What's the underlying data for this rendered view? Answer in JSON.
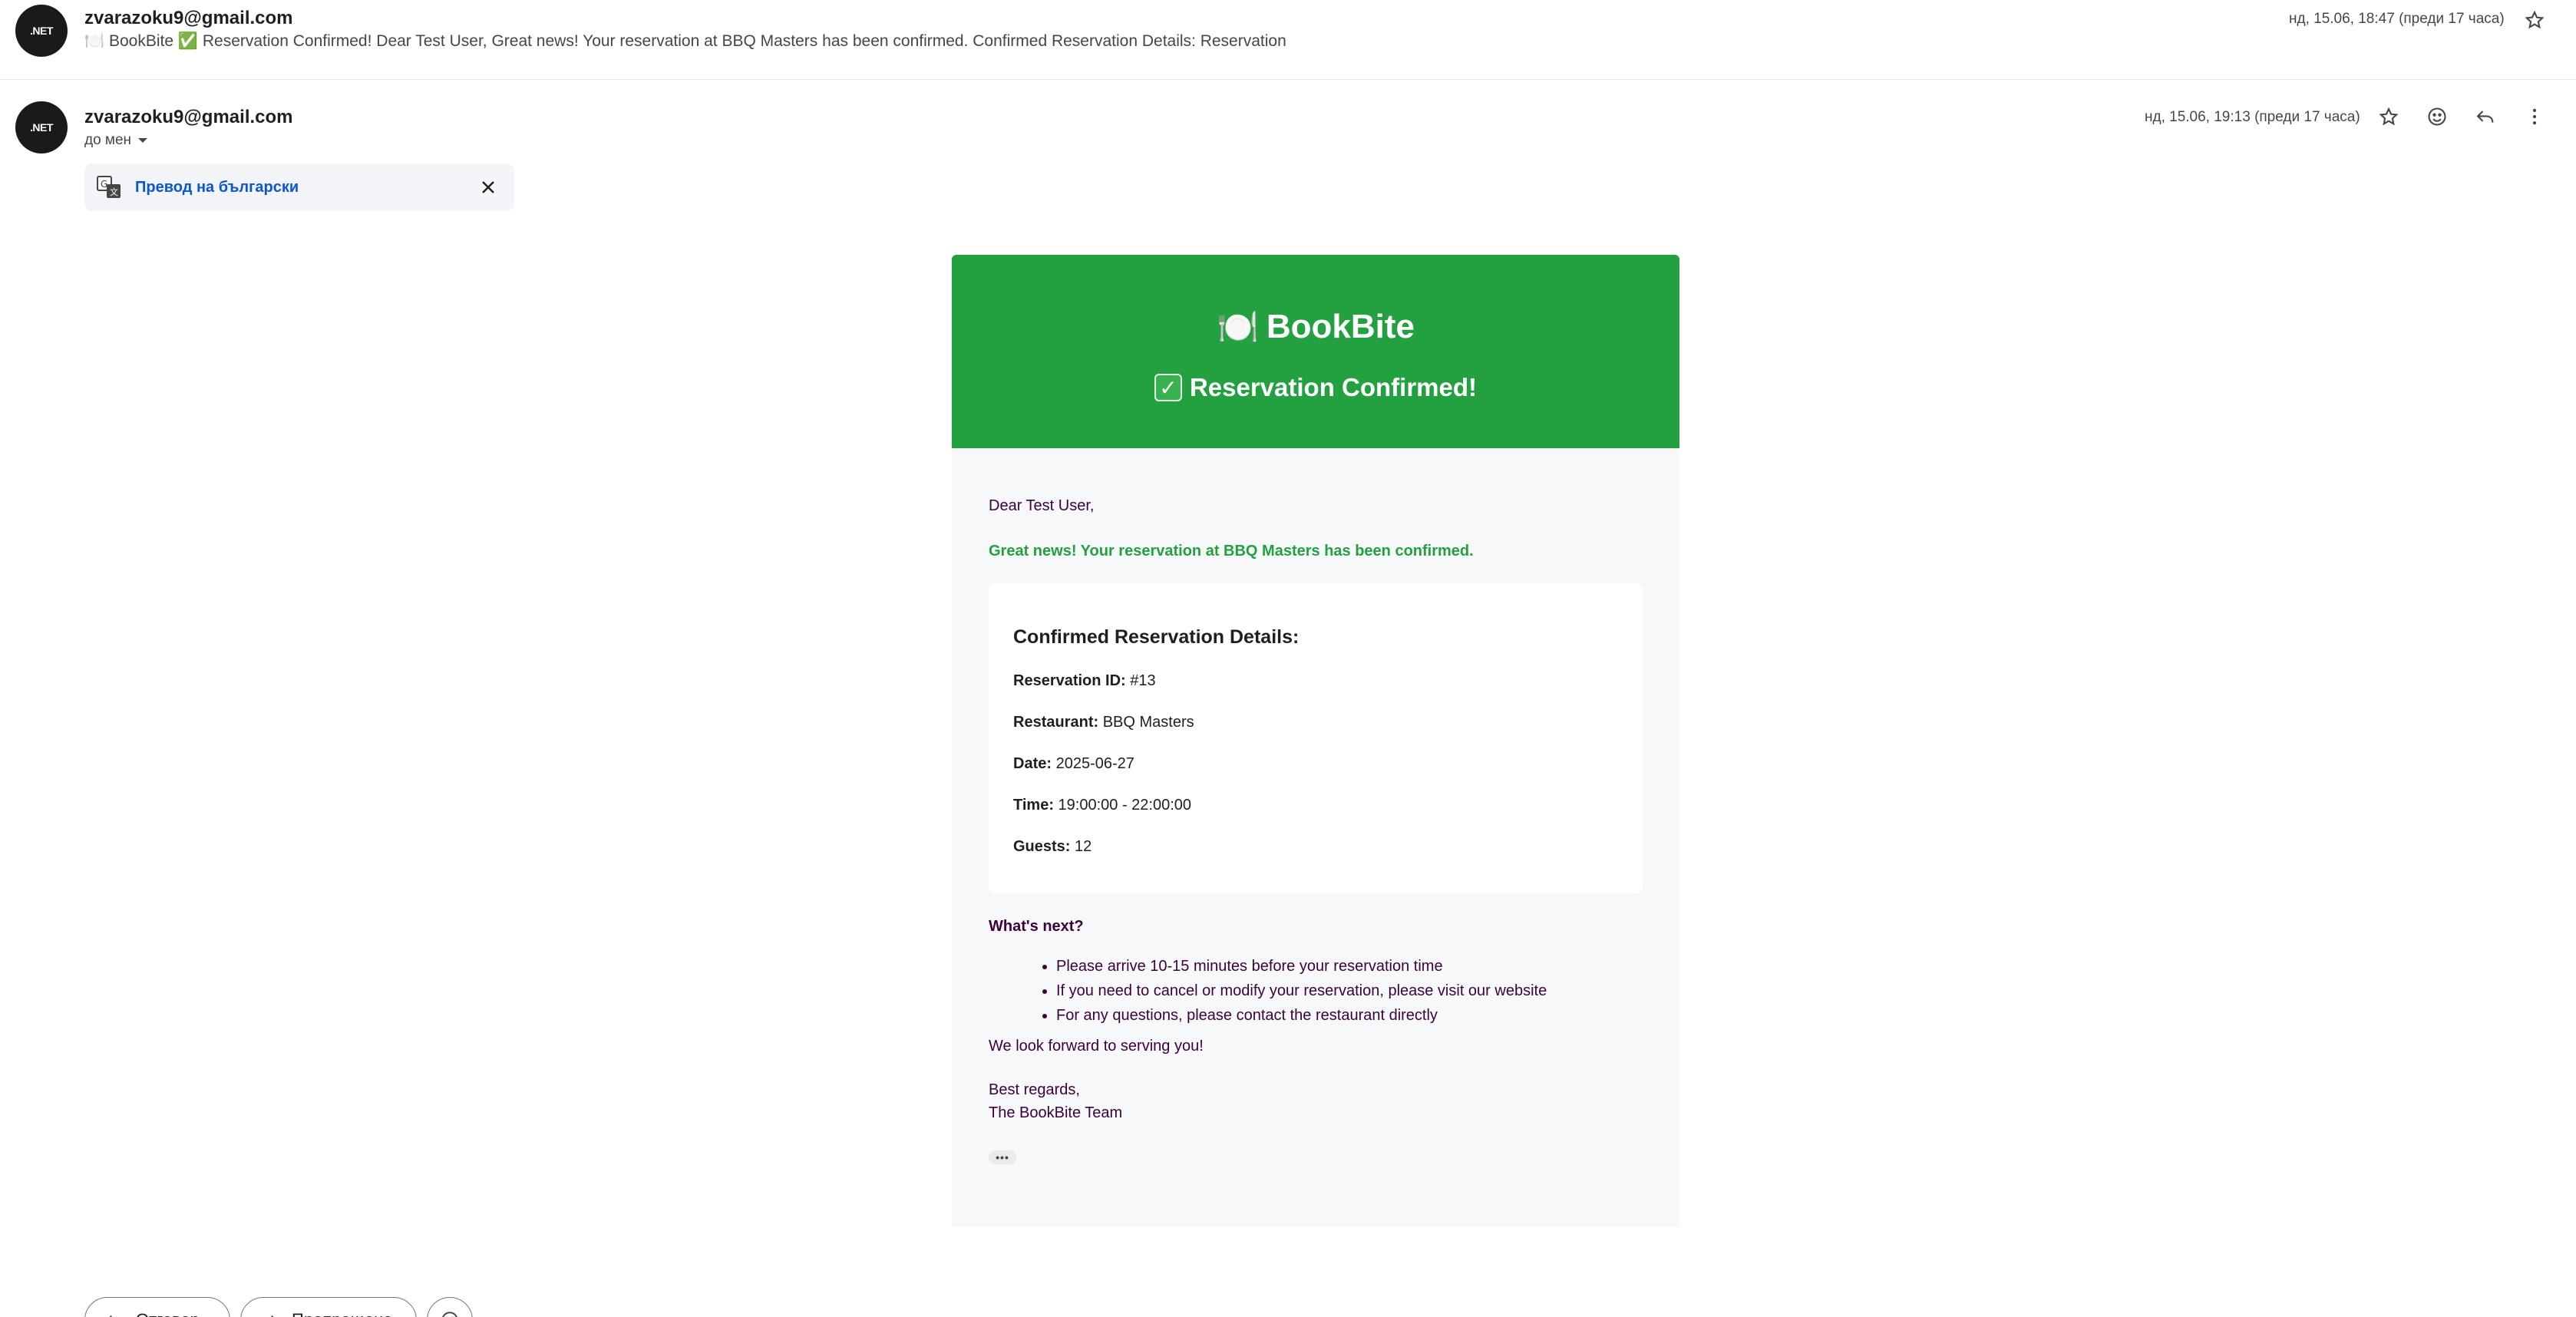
{
  "collapsed_message": {
    "avatar_text": ".NET",
    "sender": "zvarazoku9@gmail.com",
    "snippet": "🍽️ BookBite ✅ Reservation Confirmed! Dear Test User, Great news! Your reservation at BBQ Masters has been confirmed. Confirmed Reservation Details: Reservation",
    "date": "нд, 15.06, 18:47 (преди 17 часа)"
  },
  "open_message": {
    "avatar_text": ".NET",
    "sender": "zvarazoku9@gmail.com",
    "to_label": "до мен",
    "date": "нд, 15.06, 19:13 (преди 17 часа)",
    "translate_label": "Превод на български"
  },
  "email": {
    "brand": "BookBite",
    "brand_icon": "🍽️",
    "confirmed_title": "Reservation Confirmed!",
    "greeting": "Dear Test User,",
    "great_news": "Great news! Your reservation at BBQ Masters has been confirmed.",
    "details_title": "Confirmed Reservation Details:",
    "details": [
      {
        "label": "Reservation ID:",
        "value": " #13"
      },
      {
        "label": "Restaurant:",
        "value": " BBQ Masters"
      },
      {
        "label": "Date:",
        "value": " 2025-06-27"
      },
      {
        "label": "Time:",
        "value": " 19:00:00 - 22:00:00"
      },
      {
        "label": "Guests:",
        "value": " 12"
      }
    ],
    "whats_next": "What's next?",
    "next_items": [
      "Please arrive 10-15 minutes before your reservation time",
      "If you need to cancel or modify your reservation, please visit our website",
      "For any questions, please contact the restaurant directly"
    ],
    "forward": "We look forward to serving you!",
    "regards": "Best regards,",
    "team": "The BookBite Team",
    "more": "•••"
  },
  "actions": {
    "reply": "Отговор",
    "forward": "Препращане"
  },
  "colors": {
    "header_green": "#23a03f",
    "link_blue": "#0b57d0",
    "body_text": "#3d003d"
  }
}
